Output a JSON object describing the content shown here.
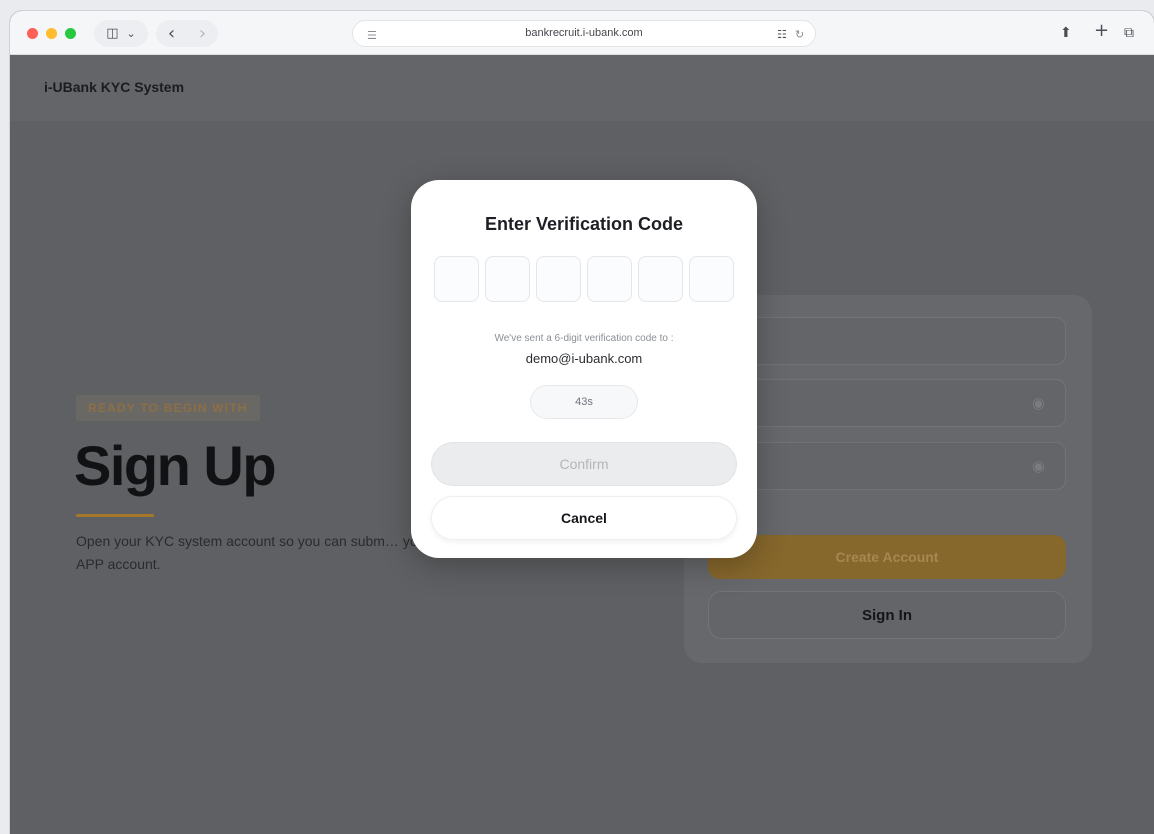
{
  "browser": {
    "url": "bankrecruit.i-ubank.com",
    "sidebar_icon": "◫",
    "chevron_icon": "⌄",
    "back_icon": "‹",
    "forward_icon": "›",
    "page_icon": "☰",
    "translate_icon": "☷",
    "reload_icon": "↻",
    "share_icon": "⬆",
    "new_tab_icon": "+",
    "tabs_icon": "⧉"
  },
  "app": {
    "brand": "i-UBank KYC System"
  },
  "hero": {
    "eyebrow": "READY TO BEGIN WITH",
    "title": "Sign Up",
    "subtitle": "Open your KYC system account so you can subm… your APP account."
  },
  "form": {
    "create_account_label": "Create Account",
    "sign_in_label": "Sign In",
    "eye_icon": "◉"
  },
  "modal": {
    "title": "Enter Verification Code",
    "sent_text": "We've sent a 6-digit verification code to :",
    "email": "demo@i-ubank.com",
    "timer": "43s",
    "confirm_label": "Confirm",
    "cancel_label": "Cancel"
  }
}
